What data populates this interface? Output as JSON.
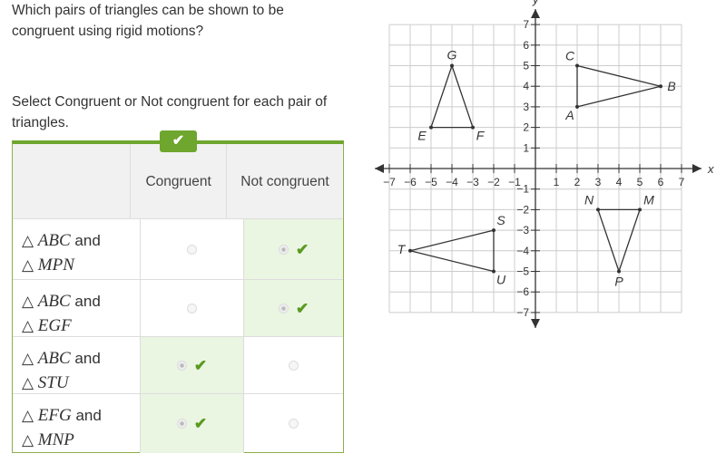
{
  "question": "Which pairs of triangles can be shown to be congruent using rigid motions?",
  "instruction": "Select Congruent or Not congruent for each pair of triangles.",
  "badge_icon": "check-icon",
  "columns": [
    "Congruent",
    "Not congruent"
  ],
  "rows": [
    {
      "a": "ABC",
      "b": "MPN",
      "and": "and",
      "selected": "Not congruent"
    },
    {
      "a": "ABC",
      "b": "EGF",
      "and": "and",
      "selected": "Not congruent"
    },
    {
      "a": "ABC",
      "b": "STU",
      "and": "and",
      "selected": "Congruent"
    },
    {
      "a": "EFG",
      "b": "MNP",
      "and": "and",
      "selected": "Congruent"
    }
  ],
  "colors": {
    "accent": "#6ea62e",
    "selected_bg": "#eaf5e2"
  },
  "chart_data": {
    "type": "scatter",
    "xlabel": "x",
    "ylabel": "y",
    "xlim": [
      -7,
      7
    ],
    "ylim": [
      -7,
      7
    ],
    "grid": true,
    "xticks": [
      -7,
      -6,
      -5,
      -4,
      -3,
      -2,
      -1,
      1,
      2,
      3,
      4,
      5,
      6,
      7
    ],
    "yticks": [
      -7,
      -6,
      -5,
      -4,
      -3,
      -2,
      -1,
      1,
      2,
      3,
      4,
      5,
      6,
      7
    ],
    "triangles": [
      {
        "points": [
          {
            "label": "A",
            "x": 2,
            "y": 3
          },
          {
            "label": "B",
            "x": 6,
            "y": 4
          },
          {
            "label": "C",
            "x": 2,
            "y": 5
          }
        ]
      },
      {
        "points": [
          {
            "label": "E",
            "x": -5,
            "y": 2
          },
          {
            "label": "F",
            "x": -3,
            "y": 2
          },
          {
            "label": "G",
            "x": -4,
            "y": 5
          }
        ]
      },
      {
        "points": [
          {
            "label": "S",
            "x": -2,
            "y": -3
          },
          {
            "label": "T",
            "x": -6,
            "y": -4
          },
          {
            "label": "U",
            "x": -2,
            "y": -5
          }
        ]
      },
      {
        "points": [
          {
            "label": "M",
            "x": 5,
            "y": -2
          },
          {
            "label": "N",
            "x": 3,
            "y": -2
          },
          {
            "label": "P",
            "x": 4,
            "y": -5
          }
        ]
      }
    ]
  }
}
